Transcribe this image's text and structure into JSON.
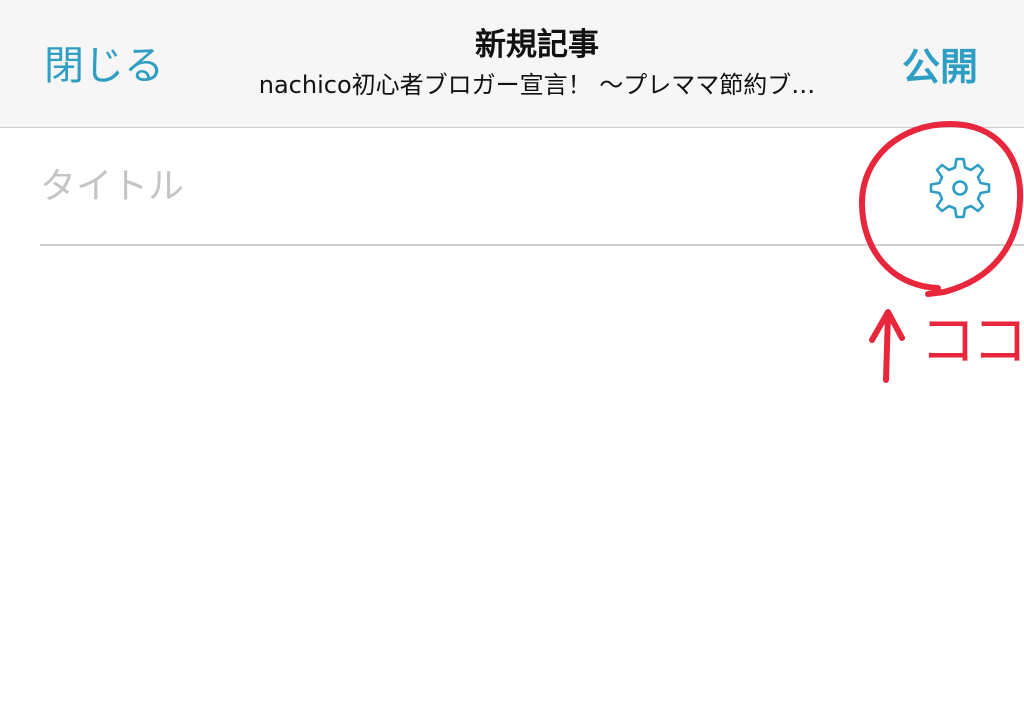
{
  "nav": {
    "close_label": "閉じる",
    "title": "新規記事",
    "subtitle": "nachico初心者ブロガー宣言！ 〜プレママ節約ブ…",
    "publish_label": "公開"
  },
  "editor": {
    "title_placeholder": "タイトル",
    "settings_icon": "gear-icon"
  },
  "annotation": {
    "label": "ココ",
    "color": "#e8263c"
  },
  "colors": {
    "accent": "#2f9ec4",
    "navbar_bg": "#f6f6f6",
    "divider": "#cfcfcf"
  }
}
